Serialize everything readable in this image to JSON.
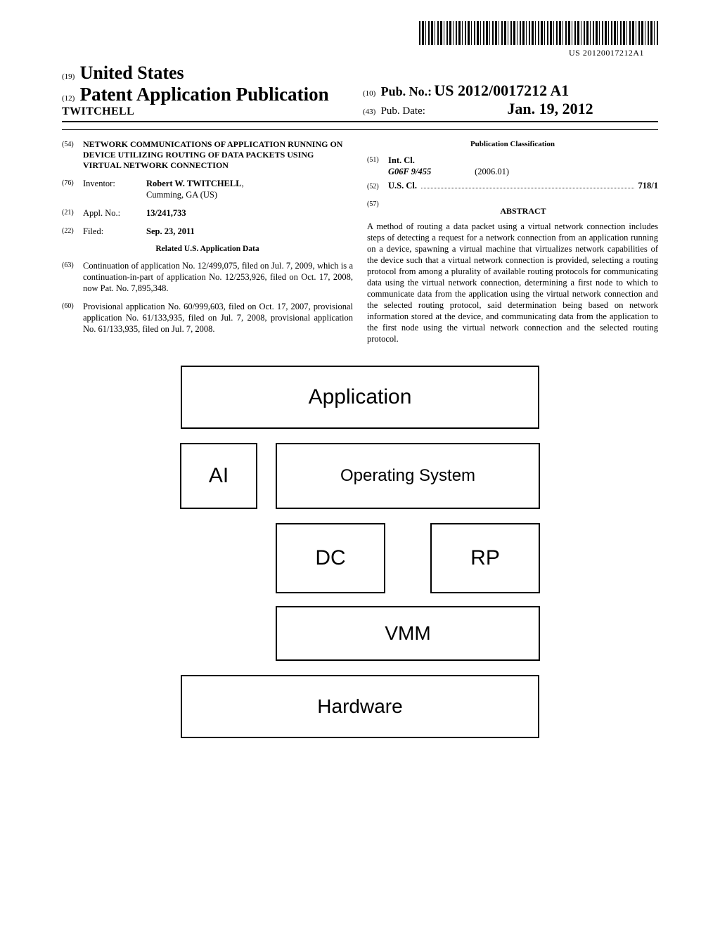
{
  "barcode_text": "US 20120017212A1",
  "header": {
    "country_prefix": "(19)",
    "country": "United States",
    "pub_prefix": "(12)",
    "pub_line": "Patent Application Publication",
    "family": "TWITCHELL",
    "pubno_prefix": "(10)",
    "pubno_label": "Pub. No.:",
    "pubno_value": "US 2012/0017212 A1",
    "pubdate_prefix": "(43)",
    "pubdate_label": "Pub. Date:",
    "pubdate_value": "Jan. 19, 2012"
  },
  "left": {
    "title_num": "(54)",
    "title": "NETWORK COMMUNICATIONS OF APPLICATION RUNNING ON DEVICE UTILIZING ROUTING OF DATA PACKETS USING VIRTUAL NETWORK CONNECTION",
    "inventor_num": "(76)",
    "inventor_label": "Inventor:",
    "inventor_name": "Robert W. TWITCHELL",
    "inventor_loc": "Cumming, GA (US)",
    "appl_num_num": "(21)",
    "appl_num_label": "Appl. No.:",
    "appl_num_value": "13/241,733",
    "filed_num": "(22)",
    "filed_label": "Filed:",
    "filed_value": "Sep. 23, 2011",
    "related_head": "Related U.S. Application Data",
    "n63_num": "(63)",
    "n63_text": "Continuation of application No. 12/499,075, filed on Jul. 7, 2009, which is a continuation-in-part of application No. 12/253,926, filed on Oct. 17, 2008, now Pat. No. 7,895,348.",
    "n60_num": "(60)",
    "n60_text": "Provisional application No. 60/999,603, filed on Oct. 17, 2007, provisional application No. 61/133,935, filed on Jul. 7, 2008, provisional application No. 61/133,935, filed on Jul. 7, 2008."
  },
  "right": {
    "pub_class_head": "Publication Classification",
    "intcl_num": "(51)",
    "intcl_label": "Int. Cl.",
    "intcl_code": "G06F 9/455",
    "intcl_date": "(2006.01)",
    "uscl_num": "(52)",
    "uscl_label": "U.S. Cl.",
    "uscl_value": "718/1",
    "abstract_num": "(57)",
    "abstract_head": "ABSTRACT",
    "abstract_body": "A method of routing a data packet using a virtual network connection includes steps of detecting a request for a network connection from an application running on a device, spawning a virtual machine that virtualizes network capabilities of the device such that a virtual network connection is provided, selecting a routing protocol from among a plurality of available routing protocols for communicating data using the virtual network connection, determining a first node to which to communicate data from the application using the virtual network connection and the selected routing protocol, said determination being based on network information stored at the device, and communicating data from the application to the first node using the virtual network connection and the selected routing protocol."
  },
  "figure": {
    "app": "Application",
    "ai": "AI",
    "os": "Operating System",
    "dc": "DC",
    "rp": "RP",
    "vmm": "VMM",
    "hw": "Hardware"
  }
}
